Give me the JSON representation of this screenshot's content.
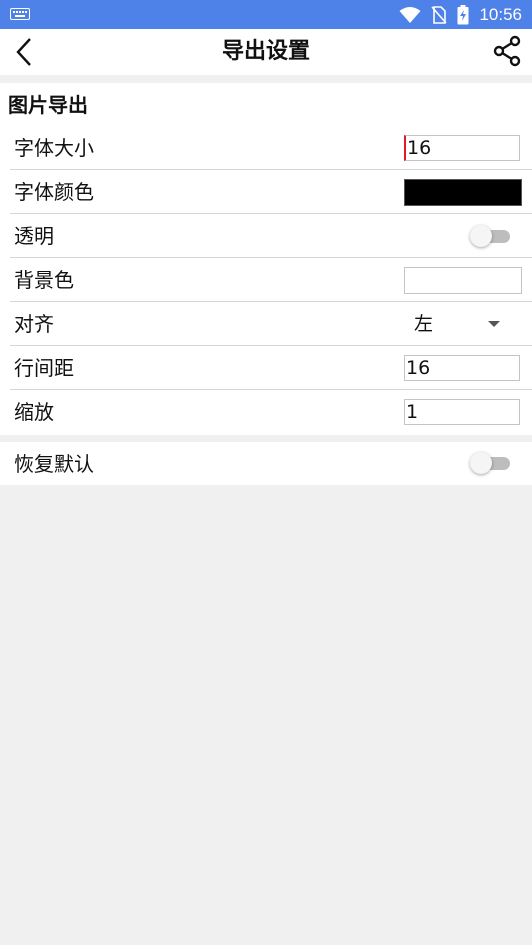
{
  "status_bar": {
    "time": "10:56",
    "icons": [
      "keyboard-icon",
      "wifi-icon",
      "no-sim-icon",
      "battery-charging-icon"
    ]
  },
  "app_bar": {
    "title": "导出设置",
    "back_icon": "back-chevron-icon",
    "share_icon": "share-icon"
  },
  "image_export": {
    "section_title": "图片导出",
    "font_size": {
      "label": "字体大小",
      "value": "16"
    },
    "font_color": {
      "label": "字体颜色",
      "color": "#000000"
    },
    "transparent": {
      "label": "透明",
      "enabled": false
    },
    "background_color": {
      "label": "背景色",
      "color": "#ffffff"
    },
    "alignment": {
      "label": "对齐",
      "value": "左"
    },
    "line_spacing": {
      "label": "行间距",
      "value": "16"
    },
    "zoom": {
      "label": "缩放",
      "value": "1"
    }
  },
  "restore_defaults": {
    "label": "恢复默认",
    "enabled": false
  },
  "colors": {
    "status_bar": "#4f82e8",
    "divider": "#d6d6d6",
    "cursor": "#e0182a"
  }
}
